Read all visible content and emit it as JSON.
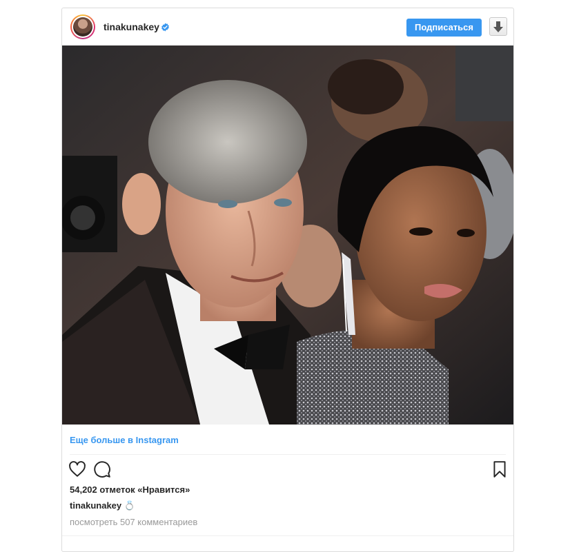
{
  "post": {
    "username": "tinakunakey",
    "verified": true,
    "follow_label": "Подписаться",
    "more_link": "Еще больше в Instagram",
    "likes_text": "54,202 отметок «Нравится»",
    "caption_user": "tinakunakey",
    "caption_text": "💍",
    "comments_text": "посмотреть 507 комментариев"
  },
  "colors": {
    "accent": "#3897f0",
    "text": "#262626",
    "muted": "#999999",
    "border": "#dbdbdb"
  },
  "icons": {
    "verified": "verified-badge-icon",
    "download": "download-arrow-icon",
    "like": "heart-icon",
    "comment": "comment-bubble-icon",
    "save": "bookmark-icon"
  }
}
